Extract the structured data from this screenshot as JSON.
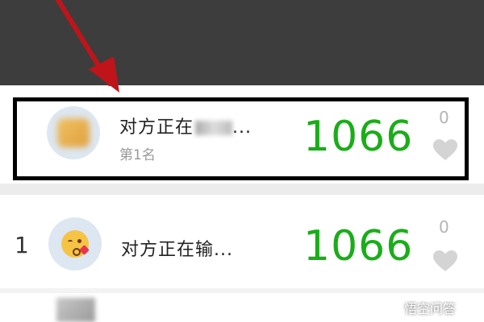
{
  "colors": {
    "score_green": "#1aad19",
    "highlight_border": "#000000",
    "arrow_red": "#c0141b",
    "header_dark": "#3d3d3d"
  },
  "my_entry": {
    "name": "对方正在",
    "ellipsis": "...",
    "rank_label": "第1名",
    "score": "1066",
    "likes": "0",
    "avatar_icon": "blurred-avatar",
    "like_icon": "heart-icon"
  },
  "leaderboard": [
    {
      "rank": "1",
      "name": "对方正在输...",
      "score": "1066",
      "likes": "0",
      "avatar_icon": "kissing-face-emoji",
      "like_icon": "heart-icon"
    }
  ],
  "watermark": {
    "text": "悟空问答"
  }
}
